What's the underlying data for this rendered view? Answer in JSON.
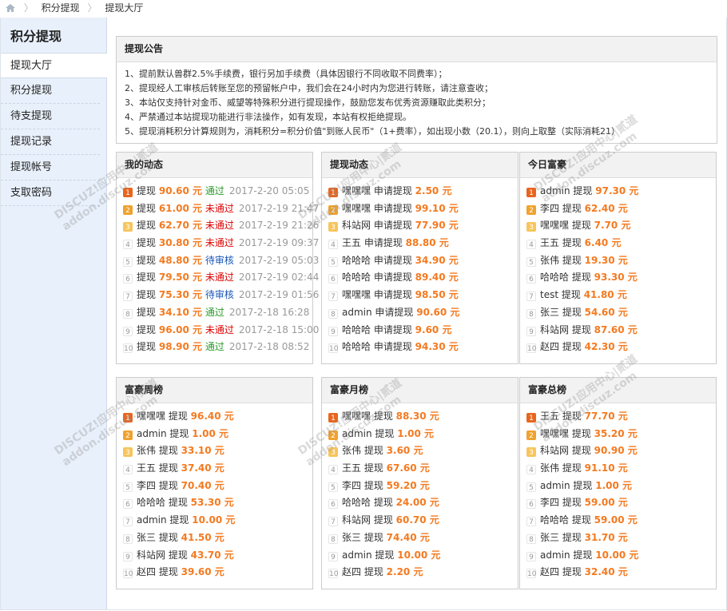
{
  "breadcrumb": [
    "积分提现",
    "提现大厅"
  ],
  "sidebar": {
    "title": "积分提现",
    "items": [
      "提现大厅",
      "积分提现",
      "待支提现",
      "提现记录",
      "提现帐号",
      "支取密码"
    ],
    "active": 0
  },
  "notice": {
    "title": "提现公告",
    "lines": [
      "1、提前默认兽群2.5%手续费，银行另加手续费（具体因银行不同收取不同费率）；",
      "2、提现经人工审核后转账至您的预留帐户中，我们会在24小时内为您进行转账，请注意查收；",
      "3、本站仅支持针对金币、威望等特殊积分进行提现操作，鼓励您发布优秀资源赚取此类积分；",
      "4、严禁通过本站提现功能进行非法操作，如有发现，本站有权拒绝提现。",
      "5、提现消耗积分计算规则为，消耗积分=积分价值\"到账人民币\"（1+费率），如出现小数（20.1），则向上取整（实际消耗21）"
    ]
  },
  "my_activity": {
    "title": "我的动态",
    "rows": [
      {
        "prefix": "提现",
        "amount": "90.60 元",
        "status": "通过",
        "status_type": "ok",
        "date": "2017-2-20 05:05"
      },
      {
        "prefix": "提现",
        "amount": "61.00 元",
        "status": "未通过",
        "status_type": "no",
        "date": "2017-2-19 21:47"
      },
      {
        "prefix": "提现",
        "amount": "62.70 元",
        "status": "未通过",
        "status_type": "no",
        "date": "2017-2-19 21:26"
      },
      {
        "prefix": "提现",
        "amount": "30.80 元",
        "status": "未通过",
        "status_type": "no",
        "date": "2017-2-19 09:37"
      },
      {
        "prefix": "提现",
        "amount": "48.80 元",
        "status": "待审核",
        "status_type": "wait",
        "date": "2017-2-19 05:03"
      },
      {
        "prefix": "提现",
        "amount": "79.50 元",
        "status": "未通过",
        "status_type": "no",
        "date": "2017-2-19 02:44"
      },
      {
        "prefix": "提现",
        "amount": "75.30 元",
        "status": "待审核",
        "status_type": "wait",
        "date": "2017-2-19 01:56"
      },
      {
        "prefix": "提现",
        "amount": "34.10 元",
        "status": "通过",
        "status_type": "ok",
        "date": "2017-2-18 16:28"
      },
      {
        "prefix": "提现",
        "amount": "96.00 元",
        "status": "未通过",
        "status_type": "no",
        "date": "2017-2-18 15:00"
      },
      {
        "prefix": "提现",
        "amount": "98.90 元",
        "status": "通过",
        "status_type": "ok",
        "date": "2017-2-18 08:52"
      }
    ]
  },
  "withdraw_activity": {
    "title": "提现动态",
    "rows": [
      {
        "text": "嘿嘿嘿 申请提现",
        "amount": "2.50 元"
      },
      {
        "text": "嘿嘿嘿 申请提现",
        "amount": "99.10 元"
      },
      {
        "text": "科站网 申请提现",
        "amount": "77.90 元"
      },
      {
        "text": "王五 申请提现",
        "amount": "88.80 元"
      },
      {
        "text": "哈哈哈 申请提现",
        "amount": "34.90 元"
      },
      {
        "text": "哈哈哈 申请提现",
        "amount": "89.40 元"
      },
      {
        "text": "嘿嘿嘿 申请提现",
        "amount": "98.50 元"
      },
      {
        "text": "admin 申请提现",
        "amount": "90.60 元"
      },
      {
        "text": "哈哈哈 申请提现",
        "amount": "9.60 元"
      },
      {
        "text": "哈哈哈 申请提现",
        "amount": "94.30 元"
      }
    ]
  },
  "today_rich": {
    "title": "今日富豪",
    "rows": [
      {
        "text": "admin 提现",
        "amount": "97.30 元"
      },
      {
        "text": "李四 提现",
        "amount": "62.40 元"
      },
      {
        "text": "嘿嘿嘿 提现",
        "amount": "7.70 元"
      },
      {
        "text": "王五 提现",
        "amount": "6.40 元"
      },
      {
        "text": "张伟 提现",
        "amount": "19.30 元"
      },
      {
        "text": "哈哈哈 提现",
        "amount": "93.30 元"
      },
      {
        "text": "test 提现",
        "amount": "41.80 元"
      },
      {
        "text": "张三 提现",
        "amount": "54.60 元"
      },
      {
        "text": "科站网 提现",
        "amount": "87.60 元"
      },
      {
        "text": "赵四 提现",
        "amount": "42.30 元"
      }
    ]
  },
  "week_rich": {
    "title": "富豪周榜",
    "rows": [
      {
        "text": "嘿嘿嘿 提现",
        "amount": "96.40 元"
      },
      {
        "text": "admin 提现",
        "amount": "1.00 元"
      },
      {
        "text": "张伟 提现",
        "amount": "33.10 元"
      },
      {
        "text": "王五 提现",
        "amount": "37.40 元"
      },
      {
        "text": "李四 提现",
        "amount": "70.40 元"
      },
      {
        "text": "哈哈哈 提现",
        "amount": "53.30 元"
      },
      {
        "text": "admin 提现",
        "amount": "10.00 元"
      },
      {
        "text": "张三 提现",
        "amount": "41.50 元"
      },
      {
        "text": "科站网 提现",
        "amount": "43.70 元"
      },
      {
        "text": "赵四 提现",
        "amount": "39.60 元"
      }
    ]
  },
  "month_rich": {
    "title": "富豪月榜",
    "rows": [
      {
        "text": "嘿嘿嘿 提现",
        "amount": "88.30 元"
      },
      {
        "text": "admin 提现",
        "amount": "1.00 元"
      },
      {
        "text": "张伟 提现",
        "amount": "3.60 元"
      },
      {
        "text": "王五 提现",
        "amount": "67.60 元"
      },
      {
        "text": "李四 提现",
        "amount": "59.20 元"
      },
      {
        "text": "哈哈哈 提现",
        "amount": "24.00 元"
      },
      {
        "text": "科站网 提现",
        "amount": "60.70 元"
      },
      {
        "text": "张三 提现",
        "amount": "74.40 元"
      },
      {
        "text": "admin 提现",
        "amount": "10.00 元"
      },
      {
        "text": "赵四 提现",
        "amount": "2.20 元"
      }
    ]
  },
  "total_rich": {
    "title": "富豪总榜",
    "rows": [
      {
        "text": "王五 提现",
        "amount": "77.70 元"
      },
      {
        "text": "嘿嘿嘿 提现",
        "amount": "35.20 元"
      },
      {
        "text": "科站网 提现",
        "amount": "90.90 元"
      },
      {
        "text": "张伟 提现",
        "amount": "91.10 元"
      },
      {
        "text": "admin 提现",
        "amount": "1.00 元"
      },
      {
        "text": "李四 提现",
        "amount": "59.00 元"
      },
      {
        "text": "哈哈哈 提现",
        "amount": "59.00 元"
      },
      {
        "text": "张三 提现",
        "amount": "31.70 元"
      },
      {
        "text": "admin 提现",
        "amount": "10.00 元"
      },
      {
        "text": "赵四 提现",
        "amount": "32.40 元"
      }
    ]
  },
  "watermark": {
    "line1": "DISCUZ!应用中心|贰道",
    "line2": "addon.discuz.com"
  },
  "colors": {
    "amount": "#f47a20",
    "pass": "#2a9b2a",
    "fail": "#d00000",
    "pending": "#1a56b8",
    "sidebar_bg": "#e8f0fb"
  }
}
